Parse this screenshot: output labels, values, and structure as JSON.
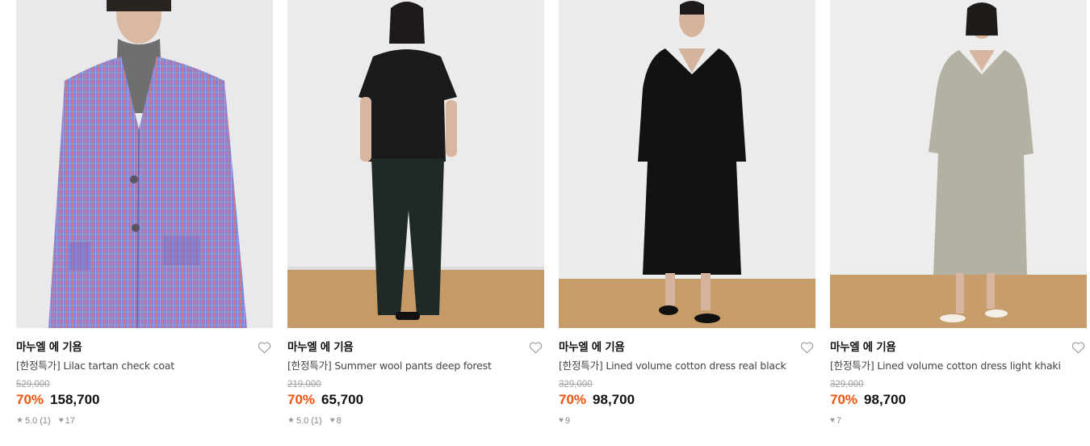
{
  "products": [
    {
      "brand": "마누엘 에 기욤",
      "name": "[한정특가] Lilac tartan check coat",
      "original_price": "529,000",
      "discount": "70%",
      "price": "158,700",
      "rating": "5.0",
      "reviews": "(1)",
      "likes": "17",
      "image_alt": "Lilac tartan check coat"
    },
    {
      "brand": "마누엘 에 기욤",
      "name": "[한정특가] Summer wool pants deep forest",
      "original_price": "219,000",
      "discount": "70%",
      "price": "65,700",
      "rating": "5.0",
      "reviews": "(1)",
      "likes": "8",
      "image_alt": "Summer wool pants deep forest"
    },
    {
      "brand": "마누엘 에 기욤",
      "name": "[한정특가] Lined volume cotton dress real black",
      "original_price": "329,000",
      "discount": "70%",
      "price": "98,700",
      "likes": "9",
      "image_alt": "Lined volume cotton dress real black"
    },
    {
      "brand": "마누엘 에 기욤",
      "name": "[한정특가] Lined volume cotton dress light khaki",
      "original_price": "329,000",
      "discount": "70%",
      "price": "98,700",
      "likes": "7",
      "image_alt": "Lined volume cotton dress light khaki"
    }
  ],
  "icons": {
    "wishlist": "heart-outline-icon",
    "rating": "star-icon",
    "likes": "heart-filled-icon"
  },
  "colors": {
    "discount": "#f0530f",
    "original_price": "#a0a0a0",
    "meta": "#888888"
  }
}
